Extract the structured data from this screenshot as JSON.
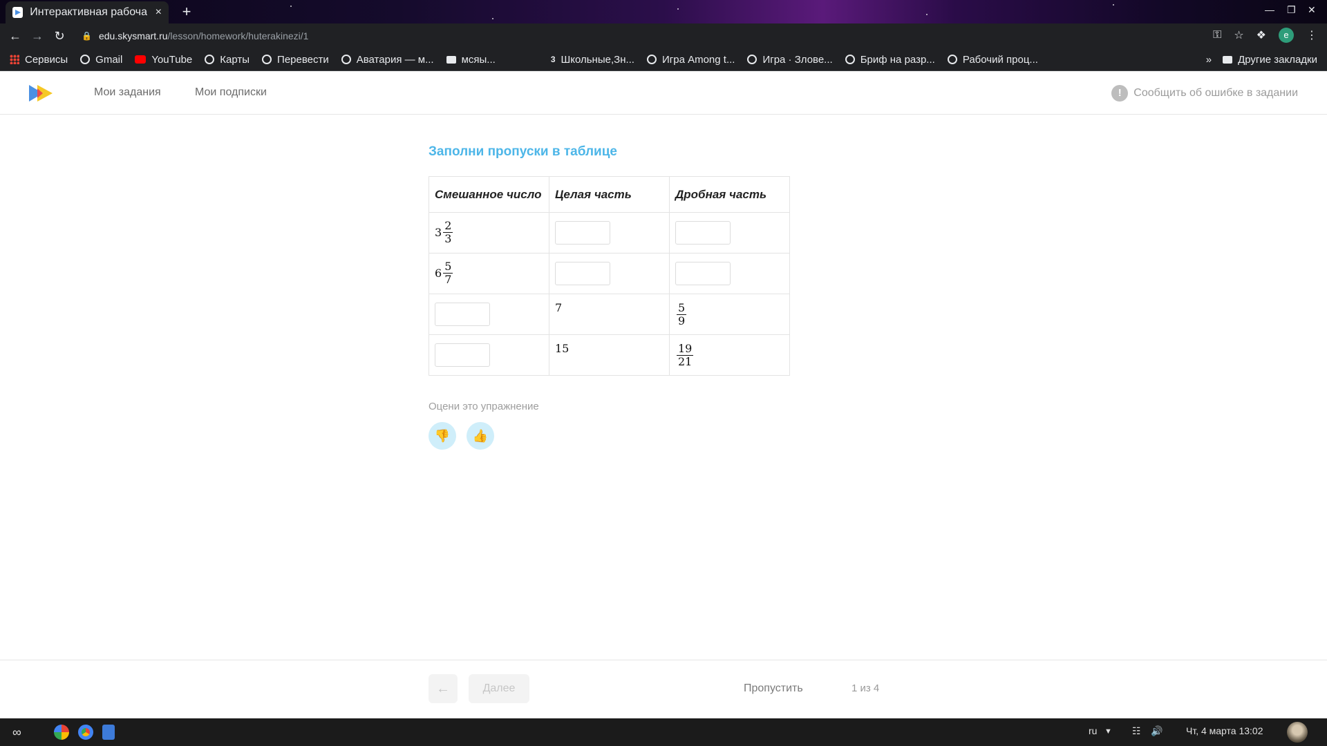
{
  "browser": {
    "tab_title": "Интерактивная рабоча",
    "tab_close": "×",
    "new_tab": "+",
    "url_host": "edu.skysmart.ru",
    "url_path": "/lesson/homework/huterakinezi/1",
    "profile_initial": "e",
    "bookmarks": [
      {
        "label": "Сервисы",
        "icon": "apps-icon"
      },
      {
        "label": "Gmail",
        "icon": "globe-icon"
      },
      {
        "label": "YouTube",
        "icon": "youtube-icon"
      },
      {
        "label": "Карты",
        "icon": "globe-icon"
      },
      {
        "label": "Перевести",
        "icon": "globe-icon"
      },
      {
        "label": "Аватария — м...",
        "icon": "globe-icon"
      },
      {
        "label": "мсяы...",
        "icon": "folder-icon"
      },
      {
        "label": "Школьные,Зн...",
        "icon": "three-icon"
      },
      {
        "label": "Игра Among t...",
        "icon": "globe-icon"
      },
      {
        "label": "Игра · Злове...",
        "icon": "globe-icon"
      },
      {
        "label": "Бриф на разр...",
        "icon": "globe-icon"
      },
      {
        "label": "Рабочий проц...",
        "icon": "globe-icon"
      }
    ],
    "more_bookmarks": "»",
    "other_bookmarks": "Другие закладки"
  },
  "header": {
    "nav": [
      "Мои задания",
      "Мои подписки"
    ],
    "report_error": "Сообщить об ошибке в задании",
    "report_icon_glyph": "!"
  },
  "task": {
    "title": "Заполни пропуски в таблице",
    "columns": [
      "Смешанное число",
      "Целая часть",
      "Дробная часть"
    ],
    "rows": [
      {
        "mixed": {
          "whole": "3",
          "num": "2",
          "den": "3"
        },
        "whole": null,
        "fraction": null
      },
      {
        "mixed": {
          "whole": "6",
          "num": "5",
          "den": "7"
        },
        "whole": null,
        "fraction": null
      },
      {
        "mixed": null,
        "whole": "7",
        "fraction": {
          "num": "5",
          "den": "9"
        }
      },
      {
        "mixed": null,
        "whole": "15",
        "fraction": {
          "num": "19",
          "den": "21"
        }
      }
    ]
  },
  "rating": {
    "label": "Оцени это упражнение"
  },
  "footer": {
    "back_glyph": "←",
    "next_label": "Далее",
    "skip_label": "Пропустить",
    "counter": "1 из 4"
  },
  "taskbar": {
    "lang": "ru",
    "datetime": "Чт, 4 марта  13:02"
  },
  "colors": {
    "accent": "#4db6e8",
    "rating_bg": "#cfeefa"
  }
}
